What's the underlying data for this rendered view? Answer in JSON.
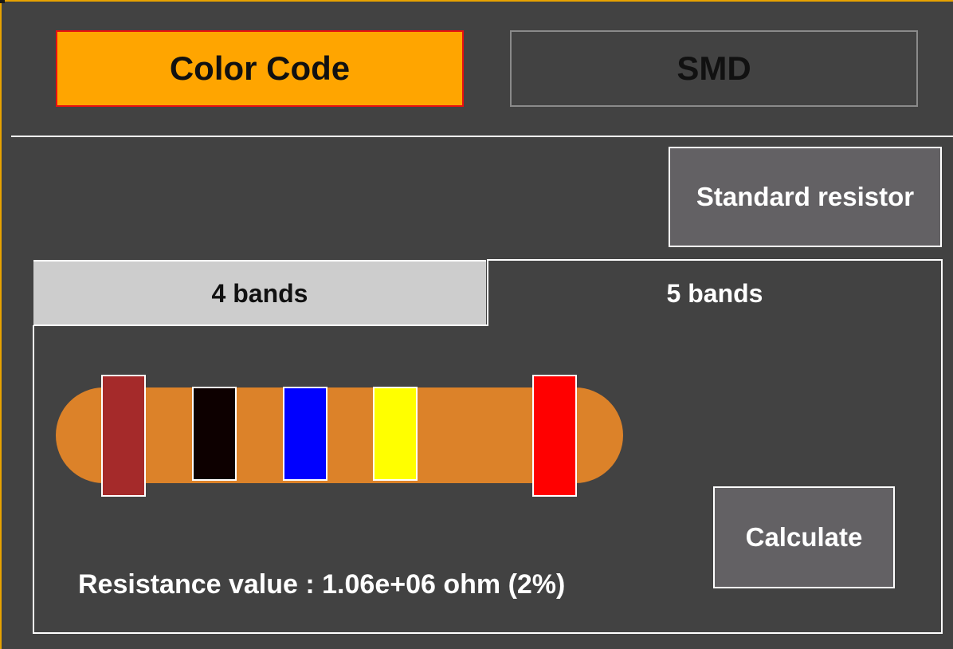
{
  "mode_tabs": {
    "color_code_label": "Color Code",
    "smd_label": "SMD",
    "active": "Color Code"
  },
  "standard_resistor_label": "Standard resistor",
  "band_tabs": {
    "four_label": "4 bands",
    "five_label": "5 bands",
    "active": "5 bands"
  },
  "resistor": {
    "body_color": "#dc8229",
    "bands": [
      {
        "name": "brown",
        "color": "#a52a2a"
      },
      {
        "name": "black",
        "color": "#0d0000"
      },
      {
        "name": "blue",
        "color": "#0000ff"
      },
      {
        "name": "yellow",
        "color": "#ffff00"
      },
      {
        "name": "red",
        "color": "#ff0000"
      }
    ]
  },
  "calculate_label": "Calculate",
  "result_text": "Resistance value : 1.06e+06 ohm (2%)",
  "colors": {
    "accent": "#ffa500",
    "background": "#424242",
    "button_bg": "#636164"
  }
}
